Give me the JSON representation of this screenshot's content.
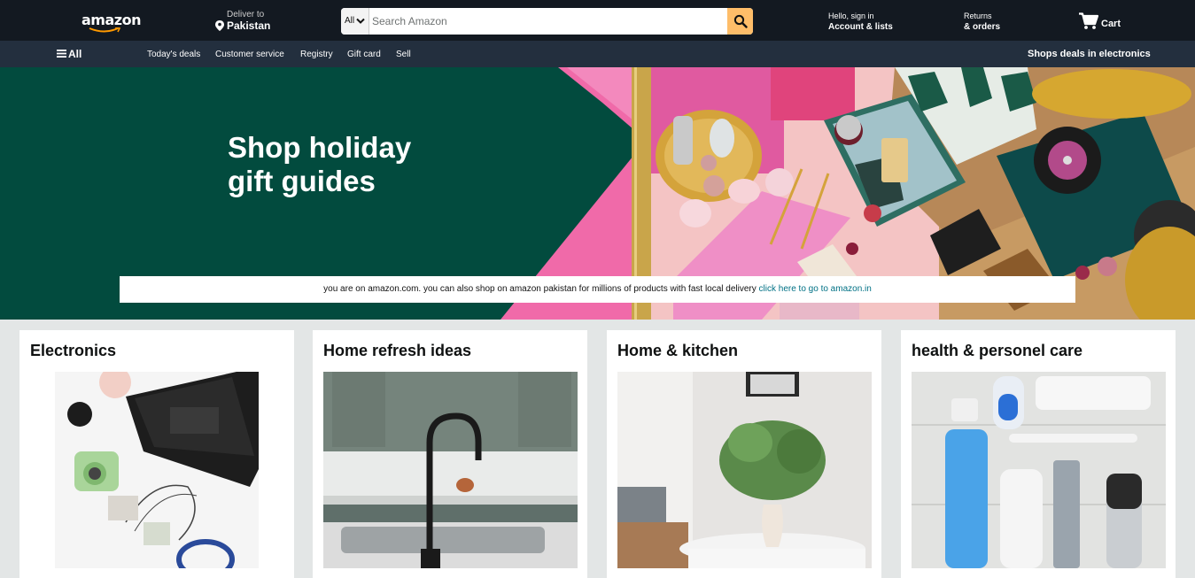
{
  "header": {
    "logo_text": "amazon",
    "deliver_line1": "Deliver to",
    "deliver_line2": "Pakistan",
    "search_category": "All",
    "search_placeholder": "Search Amazon",
    "account_line1": "Hello, sign in",
    "account_line2": "Account & lists",
    "returns_line1": "Returns",
    "returns_line2": "& orders",
    "cart_label": "Cart"
  },
  "subnav": {
    "all_label": "All",
    "links": [
      "Today's deals",
      "Customer service",
      "Registry",
      "Gift card",
      "Sell"
    ],
    "promo": "Shops deals in electronics"
  },
  "hero": {
    "title_line1": "Shop holiday",
    "title_line2": "gift guides",
    "notice_text": "you are on amazon.com. you can also shop on amazon pakistan for millions of products with fast local delivery",
    "notice_link": "click here to go to amazon.in"
  },
  "cards": [
    {
      "title": "Electronics"
    },
    {
      "title": "Home refresh ideas"
    },
    {
      "title": "Home & kitchen"
    },
    {
      "title": "health & personel care"
    }
  ],
  "colors": {
    "nav_dark": "#131921",
    "subnav": "#232f3e",
    "search_button": "#febd69",
    "hero_green": "#024b3e",
    "hero_pink": "#f06aa9",
    "link": "#007185",
    "page_bg": "#e3e6e6"
  }
}
